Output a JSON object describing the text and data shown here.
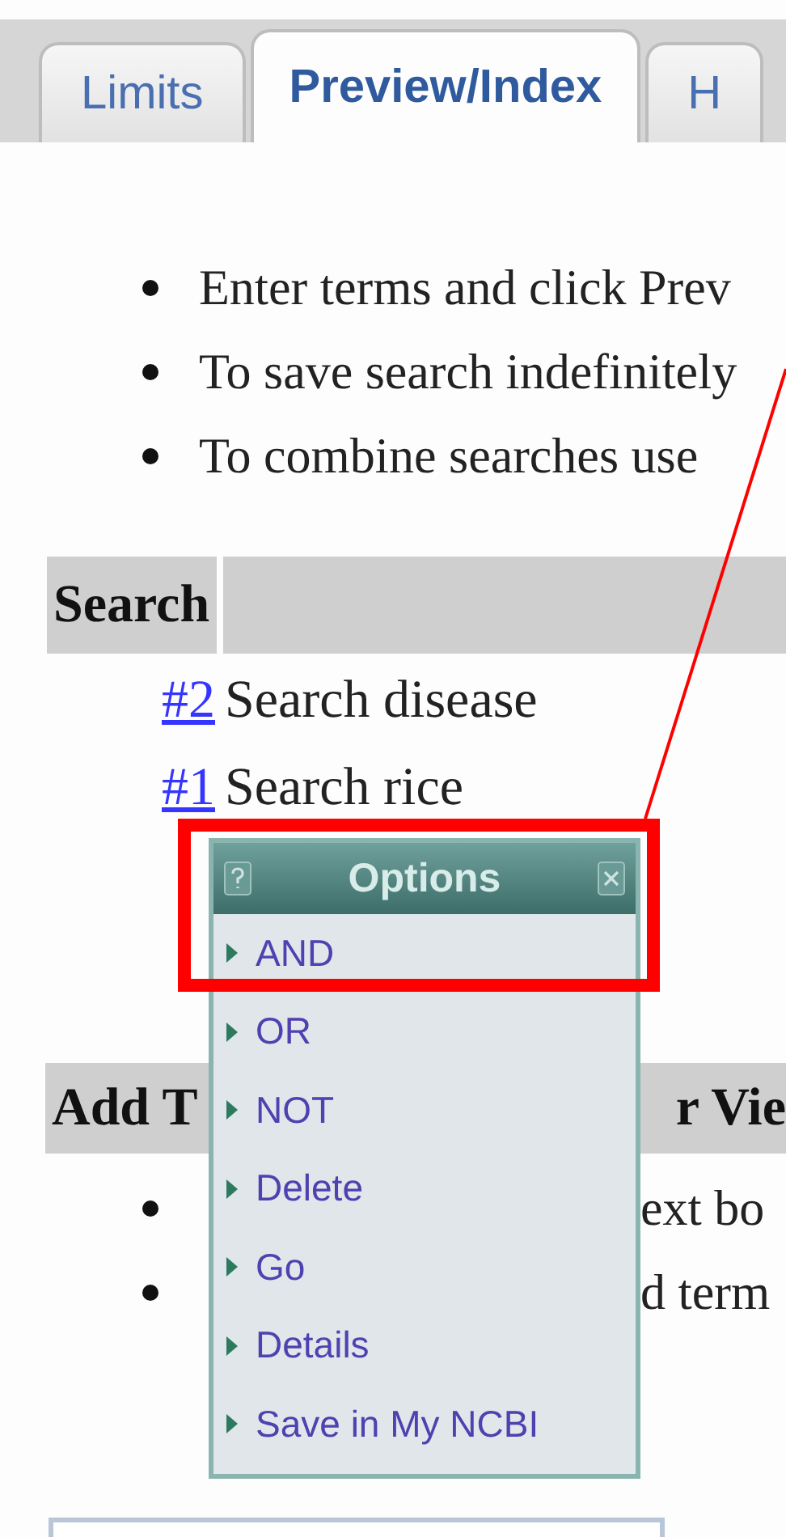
{
  "tabs": [
    {
      "label": "Limits",
      "selected": false
    },
    {
      "label": "Preview/Index",
      "selected": true
    },
    {
      "label": "H",
      "selected": false
    }
  ],
  "instructions": [
    "Enter terms and click Prev",
    "To save search indefinitely",
    "To combine searches use"
  ],
  "history_header": {
    "label": "Search"
  },
  "history": [
    {
      "number": "#2",
      "query": "Search disease"
    },
    {
      "number": "#1",
      "query": "Search rice"
    }
  ],
  "options_menu": {
    "title": "Options",
    "items": [
      "AND",
      "OR",
      "NOT",
      "Delete",
      "Go",
      "Details",
      "Save in My NCBI"
    ]
  },
  "add_terms_header": {
    "left": "Add T",
    "right": "r Vie"
  },
  "add_terms_notes": [
    "ext bo",
    "d term"
  ]
}
